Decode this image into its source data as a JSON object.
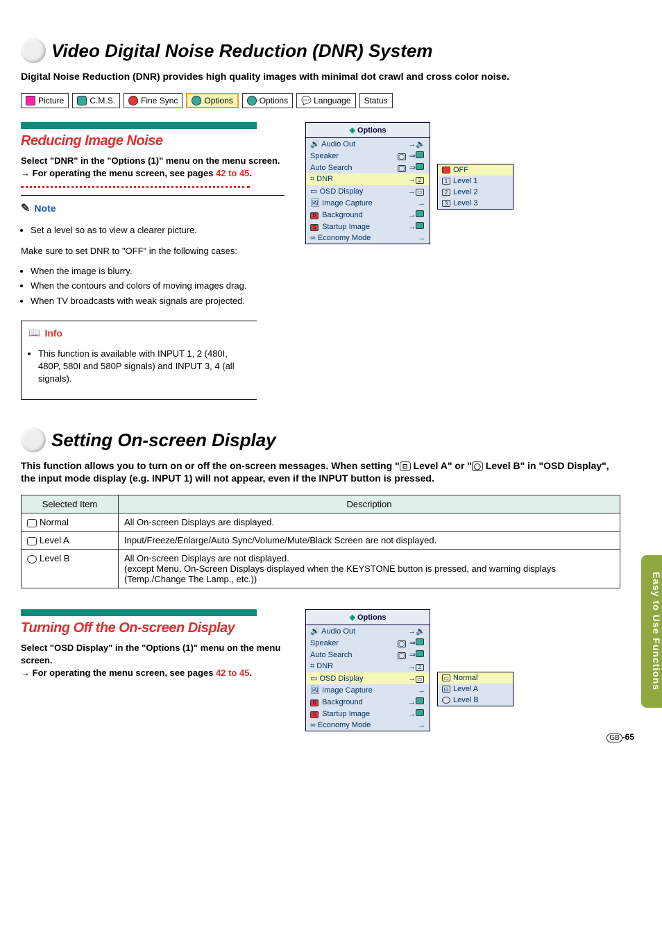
{
  "side_tab": "Easy to Use Functions",
  "section1": {
    "title": "Video Digital Noise Reduction (DNR) System",
    "intro": "Digital Noise Reduction (DNR) provides high quality images with minimal dot crawl and cross color noise."
  },
  "tabs": {
    "picture": "Picture",
    "cms": "C.M.S.",
    "finesync": "Fine Sync",
    "options1": "Options",
    "options2": "Options",
    "language": "Language",
    "status": "Status"
  },
  "reducing": {
    "heading": "Reducing Image Noise",
    "step": "Select \"DNR\" in the \"Options (1)\" menu on the menu screen.",
    "nav": "For operating the menu screen, see pages ",
    "nav_ref": "42 to 45",
    "note_label": "Note",
    "note1": "Set a level so as to view a clearer picture.",
    "note_sub": "Make sure to set DNR to \"OFF\" in the following cases:",
    "note2": "When the image is blurry.",
    "note3": "When the contours and colors of moving images drag.",
    "note4": "When TV broadcasts with weak signals are projected.",
    "info_label": "Info",
    "info_text": "This function is available with INPUT 1, 2 (480I, 480P, 580I and 580P signals) and INPUT 3, 4 (all signals)."
  },
  "osd_menu": {
    "header": "Options",
    "rows": {
      "audio_out": "Audio Out",
      "speaker": "Speaker",
      "auto_search": "Auto Search",
      "dnr": "DNR",
      "osd_display": "OSD Display",
      "image_capture": "Image Capture",
      "background": "Background",
      "startup_image": "Startup Image",
      "economy_mode": "Economy Mode"
    }
  },
  "dnr_levels": {
    "off": "OFF",
    "l1": "Level 1",
    "l2": "Level 2",
    "l3": "Level 3"
  },
  "section2": {
    "title": "Setting On-screen Display",
    "intro1": "This function allows you to turn on or off the on-screen messages. When setting \"",
    "level_a": " Level A\"",
    "intro2": " or \"",
    "level_b": " Level B\" in \"OSD Display\", the input mode display (e.g. INPUT 1) will not appear, even if the INPUT button is pressed."
  },
  "table": {
    "col1": "Selected Item",
    "col2": "Description",
    "normal": "Normal",
    "normal_desc": "All On-screen Displays are displayed.",
    "level_a": "Level A",
    "level_a_desc": "Input/Freeze/Enlarge/Auto Sync/Volume/Mute/Black Screen are not displayed.",
    "level_b": "Level B",
    "level_b_desc": "All On-screen Displays are not displayed.\n(except Menu, On-Screen Displays displayed when the KEYSTONE button is pressed, and warning displays (Temp./Change The Lamp., etc.))"
  },
  "turning_off": {
    "heading": "Turning Off the On-screen Display",
    "step": "Select \"OSD Display\" in the \"Options (1)\" menu on the menu screen.",
    "nav": "For operating the menu screen, see pages ",
    "nav_ref": "42 to 45"
  },
  "osd_levels": {
    "normal": "Normal",
    "la": "Level A",
    "lb": "Level B"
  },
  "footer": {
    "gb": "GB",
    "page": "-65"
  }
}
